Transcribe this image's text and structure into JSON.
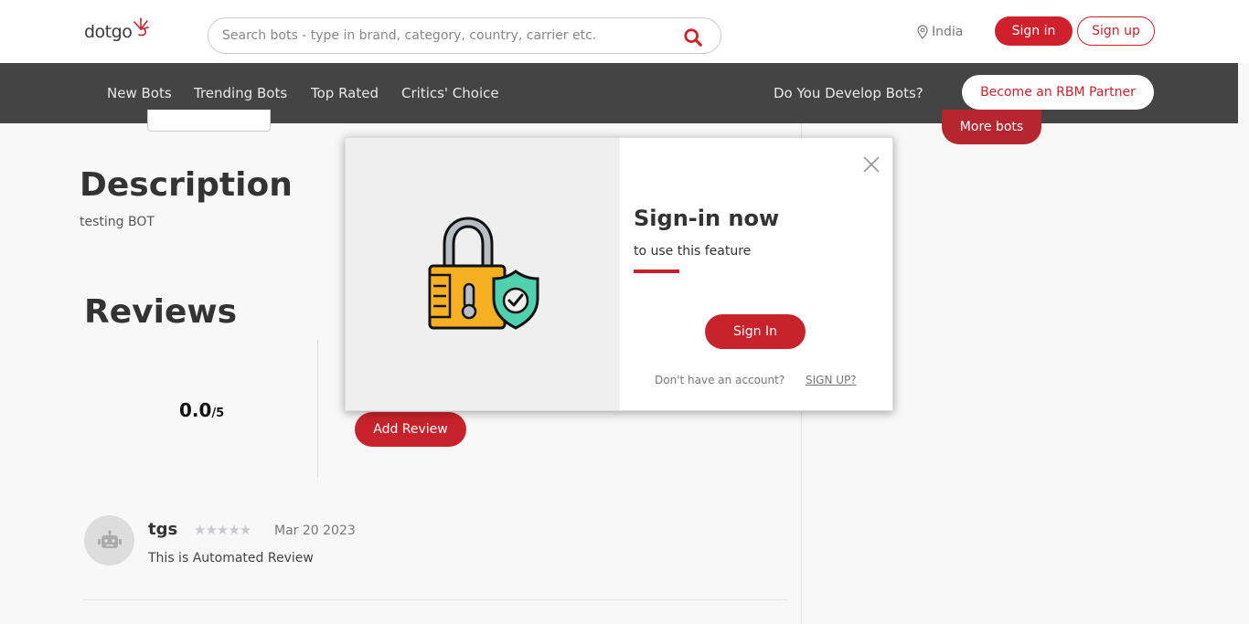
{
  "header": {
    "logo_text": "dotgo",
    "search_placeholder": "Search bots - type in brand, category, country, carrier etc.",
    "location": "India",
    "signin_label": "Sign in",
    "signup_label": "Sign up"
  },
  "nav": {
    "items": [
      "New Bots",
      "Trending Bots",
      "Top Rated",
      "Critics' Choice"
    ],
    "develop_text": "Do You Develop Bots?",
    "partner_label": "Become an RBM Partner"
  },
  "sidebar": {
    "more_bots_label": "More bots"
  },
  "description": {
    "title": "Description",
    "text": "testing BOT"
  },
  "reviews": {
    "title": "Reviews",
    "rating": "0.0",
    "rating_max": "/5",
    "add_review_label": "Add Review",
    "items": [
      {
        "user": "tgs",
        "stars": "★★★★★",
        "rating": 0,
        "date": "Mar 20 2023",
        "text": "This is Automated Review"
      }
    ]
  },
  "modal": {
    "title": "Sign-in now",
    "subtitle": "to use this feature",
    "signin_label": "Sign In",
    "no_account_text": "Don't have an account?",
    "signup_link": "SIGN UP?"
  },
  "colors": {
    "brand_red": "#d0202c",
    "nav_bg": "#444444",
    "lock_yellow": "#f5b021",
    "shield_teal": "#4fd1b0"
  },
  "icons": {
    "search": "search-icon",
    "location": "map-pin-icon",
    "close": "close-icon",
    "avatar": "robot-icon",
    "illustration": "padlock-shield-icon"
  }
}
